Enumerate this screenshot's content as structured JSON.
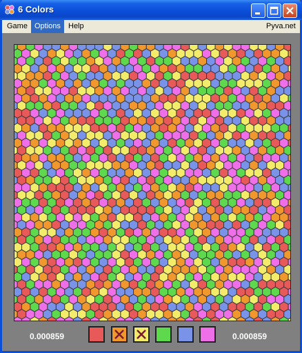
{
  "window": {
    "title": "6 Colors"
  },
  "menu": {
    "items": [
      "Game",
      "Options",
      "Help"
    ],
    "active_index": 1,
    "link": "Pyva.net"
  },
  "colors": {
    "red": "#e85959",
    "orange": "#f0982e",
    "yellow": "#f2ec6a",
    "green": "#5ed84d",
    "blue": "#7893e8",
    "pink": "#ee6fe8"
  },
  "board_colors": [
    "red",
    "orange",
    "yellow",
    "green",
    "blue",
    "pink"
  ],
  "score": {
    "left": "0.000859",
    "right": "0.000859"
  },
  "palette": [
    {
      "color": "red",
      "disabled": false
    },
    {
      "color": "orange",
      "disabled": true
    },
    {
      "color": "yellow",
      "disabled": true
    },
    {
      "color": "green",
      "disabled": false
    },
    {
      "color": "blue",
      "disabled": false
    },
    {
      "color": "pink",
      "disabled": false
    }
  ]
}
